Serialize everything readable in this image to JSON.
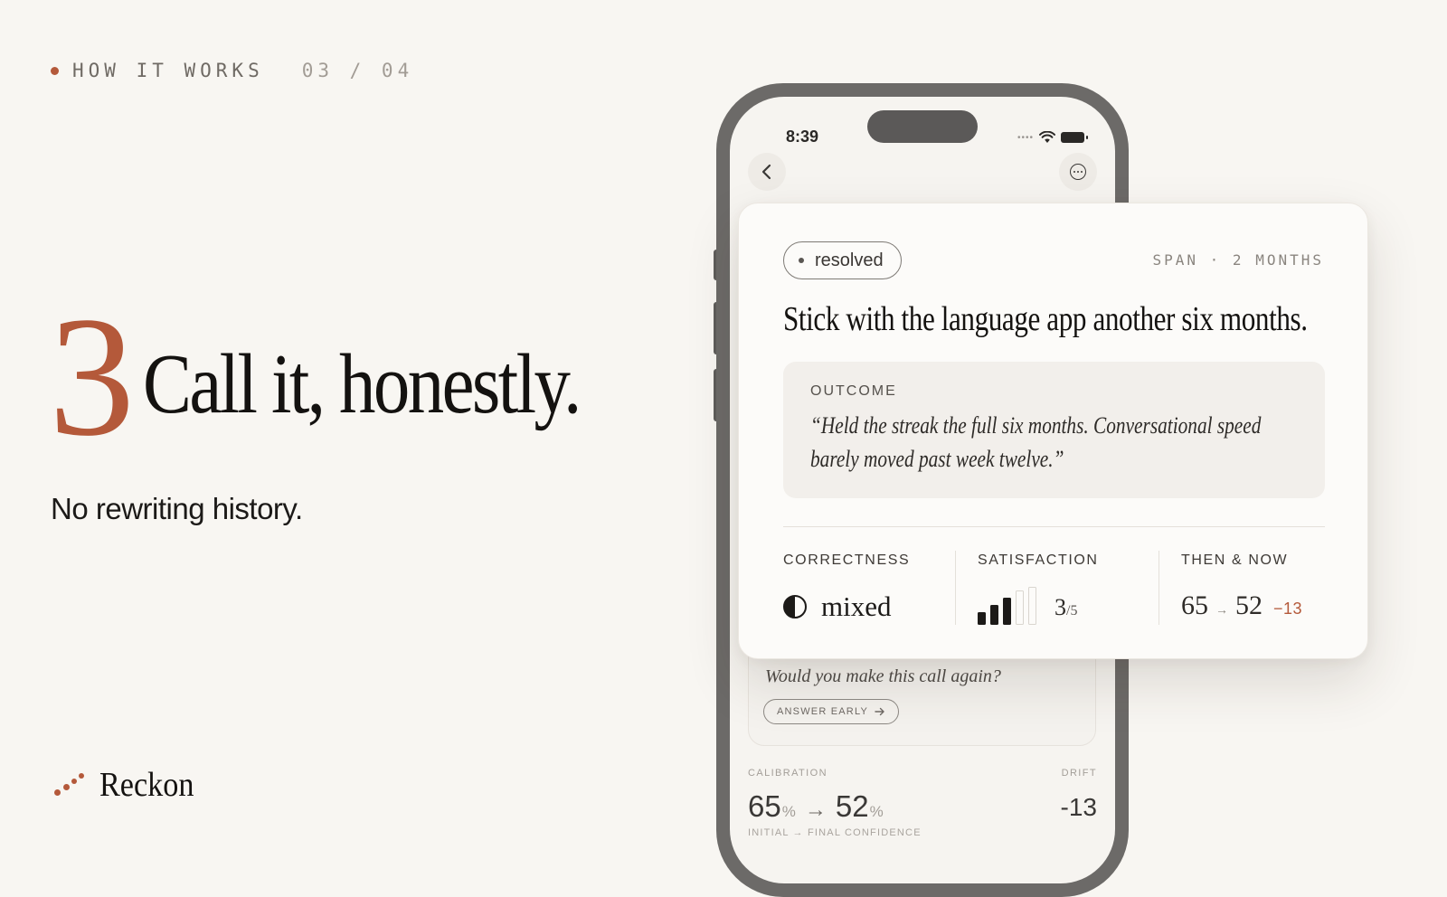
{
  "header": {
    "section_label": "HOW IT WORKS",
    "step_indicator": "03 / 04"
  },
  "hero": {
    "step_number": "3",
    "headline": "Call it, honestly.",
    "subhead": "No rewriting history."
  },
  "brand": {
    "name": "Reckon",
    "accent_color": "#b4593a"
  },
  "phone": {
    "status_time": "8:39",
    "back_icon": "chevron-left-icon",
    "more_icon": "more-horizontal-circle-icon",
    "question": "Would you make this call again?",
    "answer_button": "ANSWER EARLY",
    "calibration": {
      "label": "CALIBRATION",
      "drift_label": "DRIFT",
      "initial": "65",
      "final": "52",
      "unit": "%",
      "drift": "-13",
      "caption": "INITIAL → FINAL CONFIDENCE"
    }
  },
  "card": {
    "status": "resolved",
    "span": "SPAN · 2 MONTHS",
    "title": "Stick with the language app another six months.",
    "outcome_label": "OUTCOME",
    "outcome_quote": "“Held the streak the full six months. Conversational speed barely moved past week twelve.”",
    "metrics": {
      "correctness_label": "CORRECTNESS",
      "correctness_value": "mixed",
      "satisfaction_label": "SATISFACTION",
      "satisfaction_score": 3,
      "satisfaction_max": 5,
      "satisfaction_num": "3",
      "satisfaction_den": "/5",
      "then_now_label": "THEN & NOW",
      "then": "65",
      "now": "52",
      "delta": "−13"
    }
  }
}
